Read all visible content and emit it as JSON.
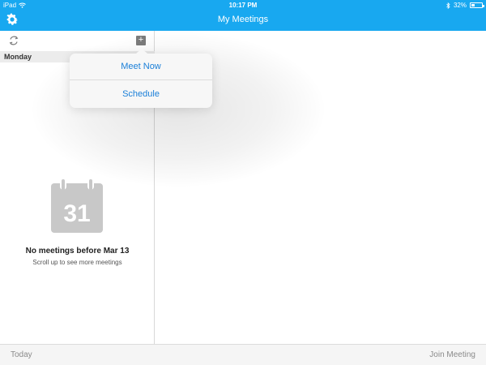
{
  "status_bar": {
    "device": "iPad",
    "time": "10:17 PM",
    "battery": "32%"
  },
  "nav": {
    "title": "My Meetings",
    "settings_icon": "gear-icon"
  },
  "left_pane": {
    "sync_icon": "sync-icon",
    "add_icon": "plus-icon",
    "add_label": "+",
    "day_header": "Monday",
    "calendar_icon_day": "31",
    "empty_title": "No meetings before Mar 13",
    "empty_subtitle": "Scroll up to see more meetings"
  },
  "popover": {
    "items": [
      {
        "label": "Meet Now"
      },
      {
        "label": "Schedule"
      }
    ]
  },
  "bottom_bar": {
    "today_label": "Today",
    "join_label": "Join Meeting"
  },
  "colors": {
    "accent": "#18a8f0",
    "link": "#1a7fd8"
  }
}
